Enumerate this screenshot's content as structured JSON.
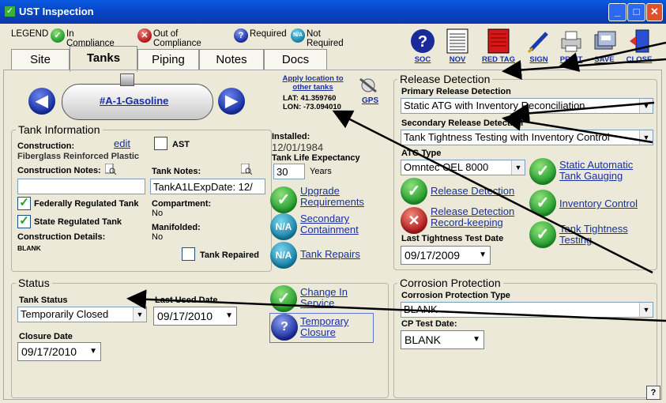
{
  "window": {
    "title": "UST Inspection",
    "min": "_",
    "max": "□",
    "close": "✕"
  },
  "legend": {
    "title": "LEGEND",
    "items": [
      {
        "label": "In Compliance",
        "icon": "check-icon",
        "color": "#1f9a2a"
      },
      {
        "label": "Out of Compliance",
        "icon": "x-icon",
        "color": "#b0171a"
      },
      {
        "label": "Required",
        "icon": "question-icon",
        "color": "#1a2a9a"
      },
      {
        "label": "Not Required",
        "icon": "na-icon",
        "color": "#157fa6",
        "glyph": "N/A"
      }
    ]
  },
  "tabs": [
    "Site",
    "Tanks",
    "Piping",
    "Notes",
    "Docs"
  ],
  "toolbar": [
    "SOC",
    "NOV",
    "RED TAG",
    "SIGN",
    "PRINT",
    "SAVE",
    "CLOSE"
  ],
  "tank_nav": {
    "name": "#A-1-Gasoline",
    "apply_location": "Apply location to other tanks",
    "lat": "LAT: 41.359760",
    "lon": "LON: -73.094010",
    "gps": "GPS"
  },
  "tank_info": {
    "title": "Tank Information",
    "construction_label": "Construction:",
    "edit": "edit",
    "construction_value": "Fiberglass Reinforced Plastic",
    "ast": "AST",
    "construction_notes_label": "Construction Notes:",
    "construction_notes_value": "",
    "tank_notes_label": "Tank Notes:",
    "tank_notes_value": "TankA1LExpDate: 12/",
    "installed_label": "Installed:",
    "installed_value": "12/01/1984",
    "life_label": "Tank Life Expectancy",
    "life_value": "30",
    "life_unit": "Years",
    "federally": "Federally Regulated Tank",
    "state": "State Regulated Tank",
    "compartment_label": "Compartment:",
    "compartment_value": "No",
    "manifolded_label": "Manifolded:",
    "manifolded_value": "No",
    "details_label": "Construction Details:",
    "details_value": "BLANK",
    "repaired": "Tank Repaired",
    "upgrade": "Upgrade Requirements",
    "secondary": "Secondary Containment",
    "repairs": "Tank Repairs",
    "na": "N/A"
  },
  "release": {
    "title": "Release Detection",
    "primary_label": "Primary Release Detection",
    "primary_value": "Static ATG with Inventory Reconciliation",
    "secondary_label": "Secondary Release Detection",
    "secondary_value": "Tank Tightness Testing with Inventory Control",
    "atg_label": "ATG Type",
    "atg_value": "Omntec OEL 8000",
    "static_atg": "Static Automatic Tank Gauging",
    "release_detection": "Release Detection",
    "inventory_control": "Inventory Control",
    "record_keeping": "Release Detection Record-keeping",
    "tightness": "Tank Tightness Testing",
    "last_test_label": "Last Tightness Test Date",
    "last_test_value": "09/17/2009"
  },
  "status": {
    "title": "Status",
    "tank_status_label": "Tank Status",
    "tank_status_value": "Temporarily Closed",
    "last_used_label": "Last Used Date",
    "last_used_value": "09/17/2010",
    "closure_label": "Closure Date",
    "closure_value": "09/17/2010",
    "change_in_service": "Change In Service",
    "temporary_closure": "Temporary Closure"
  },
  "corrosion": {
    "title": "Corrosion Protection",
    "type_label": "Corrosion Protection Type",
    "type_value": "BLANK",
    "cp_label": "CP Test Date:",
    "cp_value": "BLANK"
  },
  "help": "?"
}
